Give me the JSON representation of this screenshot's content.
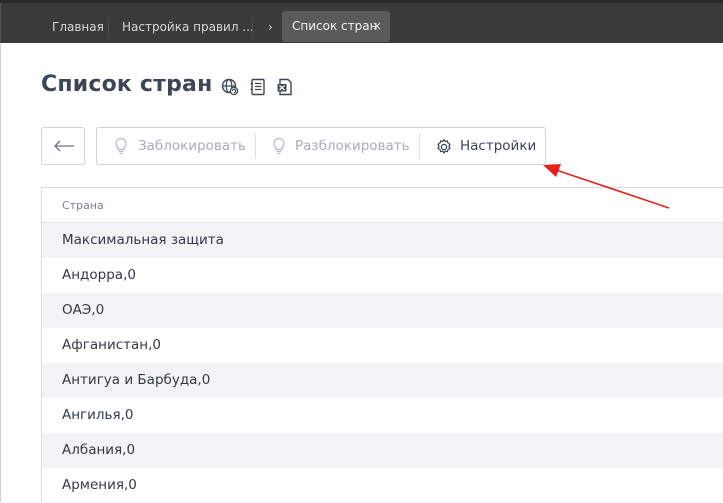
{
  "breadcrumbs": [
    "Главная",
    "Настройка правил ...",
    "Список стран"
  ],
  "active_tab_close": "×",
  "page": {
    "title": "Список стран"
  },
  "toolbar": {
    "block_label": "Заблокировать",
    "unblock_label": "Разблокировать",
    "settings_label": "Настройки"
  },
  "table": {
    "header": "Страна",
    "rows": [
      "Максимальная защита",
      "Андорра,0",
      "ОАЭ,0",
      "Афганистан,0",
      "Антигуа и Барбуда,0",
      "Ангилья,0",
      "Албания,0",
      "Армения,0"
    ]
  },
  "colors": {
    "topbar": "#3a3a3a",
    "active_tab": "#5a5a5a",
    "annotation_arrow": "#e8201c"
  },
  "icons": [
    "globe-refresh-icon",
    "document-list-icon",
    "excel-export-icon",
    "back-arrow-icon",
    "lightbulb-icon",
    "gear-icon",
    "chevron-right-icon",
    "close-icon"
  ]
}
